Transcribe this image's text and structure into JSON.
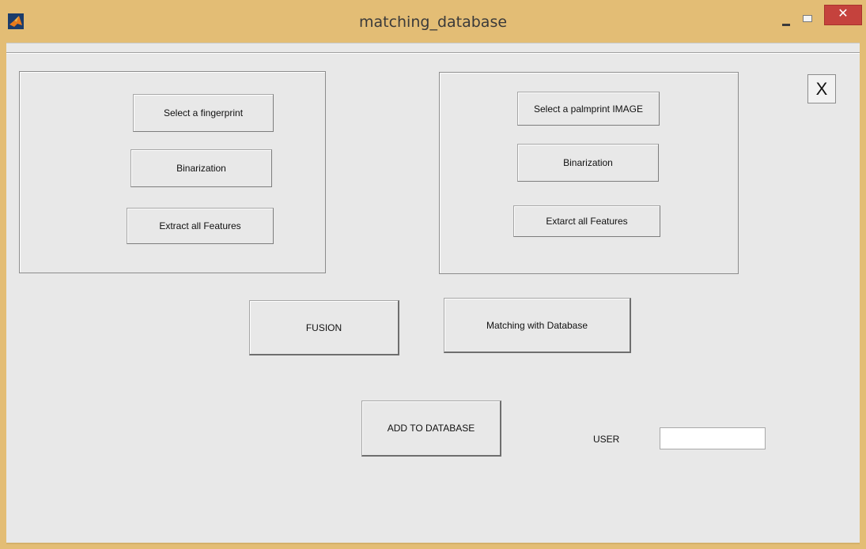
{
  "window": {
    "title": "matching_database",
    "close_glyph": "✕",
    "colors": {
      "titlebar": "#e3bd75",
      "client": "#e8e8e8",
      "close": "#c5423d"
    }
  },
  "close_button": {
    "label": "X"
  },
  "fingerprint_panel": {
    "select_label": "Select a fingerprint",
    "binarize_label": "Binarization",
    "extract_label": "Extract all Features"
  },
  "palmprint_panel": {
    "select_label": "Select a palmprint IMAGE",
    "binarize_label": "Binarization",
    "extract_label": "Extarct all Features"
  },
  "actions": {
    "fusion_label": "FUSION",
    "matching_label": "Matching with Database",
    "add_label": "ADD TO DATABASE"
  },
  "user": {
    "label": "USER",
    "value": ""
  }
}
